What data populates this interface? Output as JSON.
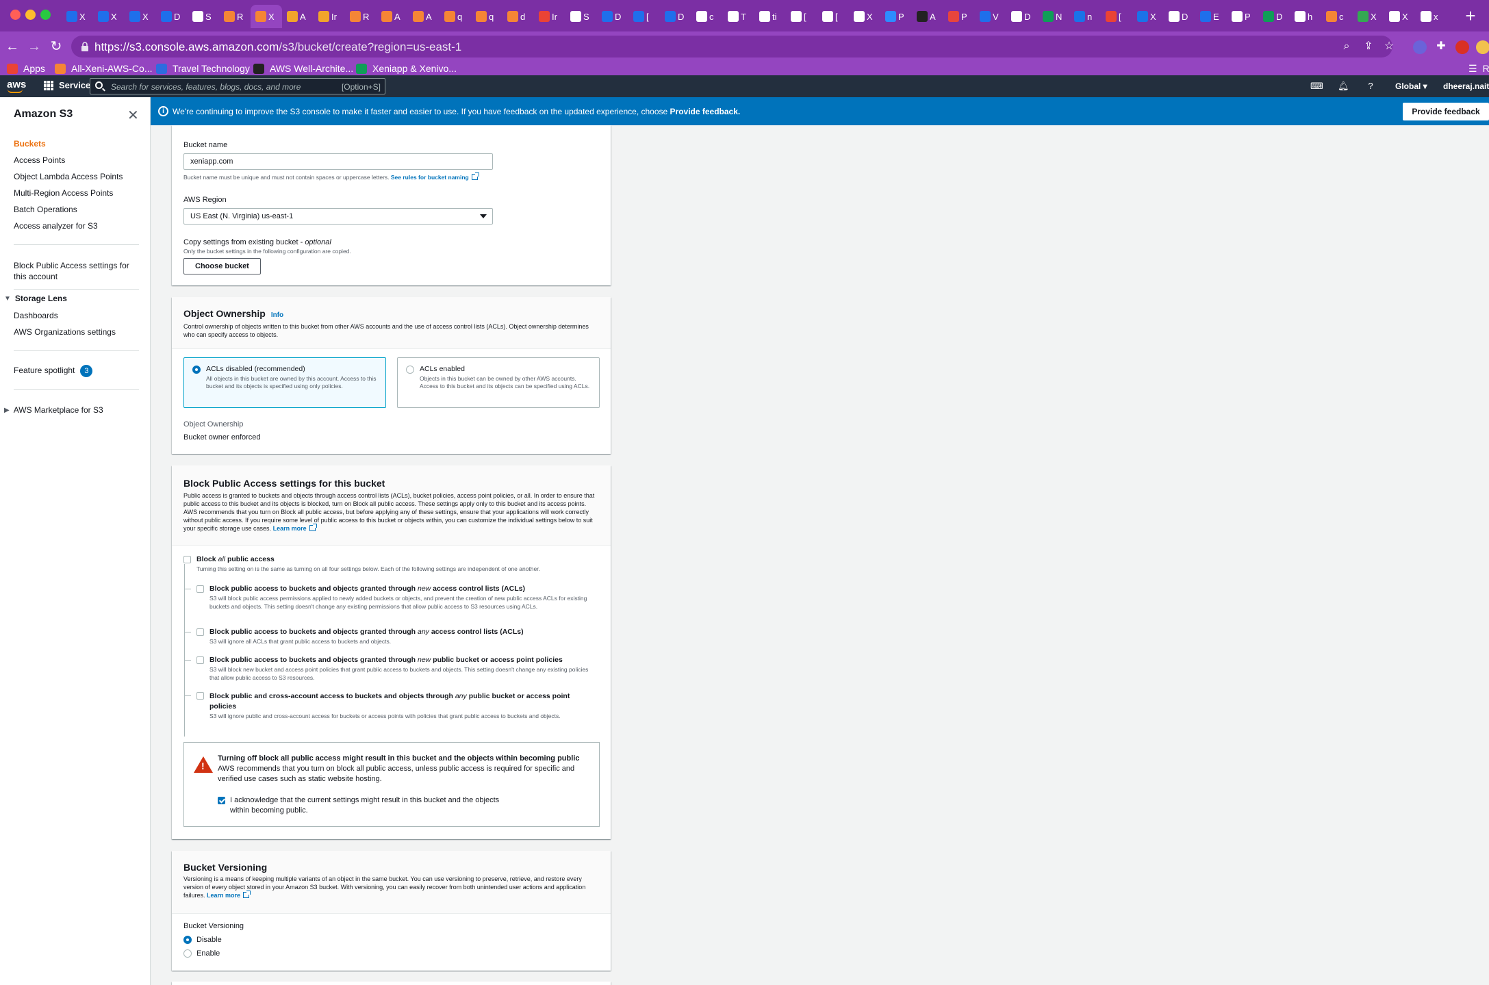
{
  "browser": {
    "url_host": "https://s3.console.aws.amazon.com",
    "url_path": "/s3/bucket/create?region=us-east-1",
    "tabs": [
      {
        "label": "X",
        "color": "#1f6feb"
      },
      {
        "label": "X",
        "color": "#1f6feb"
      },
      {
        "label": "X",
        "color": "#1f6feb"
      },
      {
        "label": "D",
        "color": "#1f6feb"
      },
      {
        "label": "S",
        "color": "#ffffff"
      },
      {
        "label": "R",
        "color": "#f58536"
      },
      {
        "label": "X",
        "color": "#f58536",
        "active": true
      },
      {
        "label": "A",
        "color": "#f2a42b"
      },
      {
        "label": "Ir",
        "color": "#f2a42b"
      },
      {
        "label": "R",
        "color": "#f58536"
      },
      {
        "label": "A",
        "color": "#f58536"
      },
      {
        "label": "A",
        "color": "#f58536"
      },
      {
        "label": "q",
        "color": "#f58536"
      },
      {
        "label": "q",
        "color": "#f58536"
      },
      {
        "label": "d",
        "color": "#f58536"
      },
      {
        "label": "Ir",
        "color": "#ea4335"
      },
      {
        "label": "S",
        "color": "#ffffff"
      },
      {
        "label": "D",
        "color": "#1f6feb"
      },
      {
        "label": "[",
        "color": "#1f6feb"
      },
      {
        "label": "D",
        "color": "#1f6feb"
      },
      {
        "label": "c",
        "color": "#ffffff"
      },
      {
        "label": "T",
        "color": "#ffffff"
      },
      {
        "label": "ti",
        "color": "#ffffff"
      },
      {
        "label": "[",
        "color": "#ffffff"
      },
      {
        "label": "[",
        "color": "#ffffff"
      },
      {
        "label": "X",
        "color": "#ffffff"
      },
      {
        "label": "P",
        "color": "#2d8cff"
      },
      {
        "label": "A",
        "color": "#222222"
      },
      {
        "label": "P",
        "color": "#e8453c"
      },
      {
        "label": "V",
        "color": "#1f6feb"
      },
      {
        "label": "D",
        "color": "#ffffff"
      },
      {
        "label": "N",
        "color": "#0f9d58"
      },
      {
        "label": "n",
        "color": "#1a73e8"
      },
      {
        "label": "[",
        "color": "#ea4335"
      },
      {
        "label": "X",
        "color": "#1a73e8"
      },
      {
        "label": "D",
        "color": "#ffffff"
      },
      {
        "label": "E",
        "color": "#1f6feb"
      },
      {
        "label": "P",
        "color": "#ffffff"
      },
      {
        "label": "D",
        "color": "#0f9d58"
      },
      {
        "label": "h",
        "color": "#ffffff"
      },
      {
        "label": "c",
        "color": "#f58536"
      },
      {
        "label": "X",
        "color": "#34a853"
      },
      {
        "label": "X",
        "color": "#ffffff"
      },
      {
        "label": "x",
        "color": "#ffffff"
      }
    ],
    "new_tab_label": "+",
    "bookmarks": [
      {
        "label": "Apps",
        "color": "#ea4335"
      },
      {
        "label": "All-Xeni-AWS-Co...",
        "color": "#f58536"
      },
      {
        "label": "Travel Technology",
        "color": "#2d6cdf"
      },
      {
        "label": "AWS Well-Archite...",
        "color": "#222222"
      },
      {
        "label": "Xeniapp & Xenivo...",
        "color": "#0f9d58"
      }
    ],
    "bookmarks_overflow": "R"
  },
  "aws_header": {
    "logo": "aws",
    "services_label": "Services",
    "search_placeholder": "Search for services, features, blogs, docs, and more",
    "search_shortcut": "[Option+S]",
    "region_label": "Global",
    "account_label": "dheeraj.naithan"
  },
  "sidenav": {
    "title": "Amazon S3",
    "items": [
      "Buckets",
      "Access Points",
      "Object Lambda Access Points",
      "Multi-Region Access Points",
      "Batch Operations",
      "Access analyzer for S3"
    ],
    "block_public_label": "Block Public Access settings for this account",
    "storage_lens": {
      "label": "Storage Lens",
      "items": [
        "Dashboards",
        "AWS Organizations settings"
      ]
    },
    "feature_spotlight": {
      "label": "Feature spotlight",
      "badge": "3"
    },
    "marketplace_label": "AWS Marketplace for S3"
  },
  "flash": {
    "message": "We're continuing to improve the S3 console to make it faster and easier to use. If you have feedback on the updated experience, choose",
    "message_bold": "Provide feedback.",
    "button_label": "Provide feedback"
  },
  "general": {
    "bucket_name_label": "Bucket name",
    "bucket_name_value": "xeniapp.com",
    "bucket_name_hint": "Bucket name must be unique and must not contain spaces or uppercase letters.",
    "bucket_name_link": "See rules for bucket naming",
    "region_label": "AWS Region",
    "region_value": "US East (N. Virginia) us-east-1",
    "copy_label": "Copy settings from existing bucket -",
    "copy_optional": "optional",
    "copy_hint": "Only the bucket settings in the following configuration are copied.",
    "choose_bucket_button": "Choose bucket"
  },
  "ownership": {
    "title": "Object Ownership",
    "info": "Info",
    "description": "Control ownership of objects written to this bucket from other AWS accounts and the use of access control lists (ACLs). Object ownership determines who can specify access to objects.",
    "options": [
      {
        "title": "ACLs disabled (recommended)",
        "desc": "All objects in this bucket are owned by this account. Access to this bucket and its objects is specified using only policies.",
        "selected": true
      },
      {
        "title": "ACLs enabled",
        "desc": "Objects in this bucket can be owned by other AWS accounts. Access to this bucket and its objects can be specified using ACLs.",
        "selected": false
      }
    ],
    "result_label": "Object Ownership",
    "result_value": "Bucket owner enforced"
  },
  "block_public": {
    "title": "Block Public Access settings for this bucket",
    "description": "Public access is granted to buckets and objects through access control lists (ACLs), bucket policies, access point policies, or all. In order to ensure that public access to this bucket and its objects is blocked, turn on Block all public access. These settings apply only to this bucket and its access points. AWS recommends that you turn on Block all public access, but before applying any of these settings, ensure that your applications will work correctly without public access. If you require some level of public access to this bucket or objects within, you can customize the individual settings below to suit your specific storage use cases.",
    "learn_more": "Learn more",
    "block_all": {
      "pre": "Block",
      "em": "all",
      "post": "public access",
      "desc": "Turning this setting on is the same as turning on all four settings below. Each of the following settings are independent of one another."
    },
    "options": [
      {
        "pre": "Block public access to buckets and objects granted through",
        "em": "new",
        "post": "access control lists (ACLs)",
        "desc": "S3 will block public access permissions applied to newly added buckets or objects, and prevent the creation of new public access ACLs for existing buckets and objects. This setting doesn't change any existing permissions that allow public access to S3 resources using ACLs."
      },
      {
        "pre": "Block public access to buckets and objects granted through",
        "em": "any",
        "post": "access control lists (ACLs)",
        "desc": "S3 will ignore all ACLs that grant public access to buckets and objects."
      },
      {
        "pre": "Block public access to buckets and objects granted through",
        "em": "new",
        "post": "public bucket or access point policies",
        "desc": "S3 will block new bucket and access point policies that grant public access to buckets and objects. This setting doesn't change any existing policies that allow public access to S3 resources."
      },
      {
        "pre": "Block public and cross-account access to buckets and objects through",
        "em": "any",
        "post": "public bucket or access point policies",
        "desc": "S3 will ignore public and cross-account access for buckets or access points with policies that grant public access to buckets and objects."
      }
    ],
    "alert_title": "Turning off block all public access might result in this bucket and the objects within becoming public",
    "alert_body": "AWS recommends that you turn on block all public access, unless public access is required for specific and verified use cases such as static website hosting.",
    "acknowledge": "I acknowledge that the current settings might result in this bucket and the objects within becoming public."
  },
  "versioning": {
    "title": "Bucket Versioning",
    "description": "Versioning is a means of keeping multiple variants of an object in the same bucket. You can use versioning to preserve, retrieve, and restore every version of every object stored in your Amazon S3 bucket. With versioning, you can easily recover from both unintended user actions and application failures.",
    "learn_more": "Learn more",
    "field_label": "Bucket Versioning",
    "options": [
      "Disable",
      "Enable"
    ],
    "selected": "Disable"
  }
}
